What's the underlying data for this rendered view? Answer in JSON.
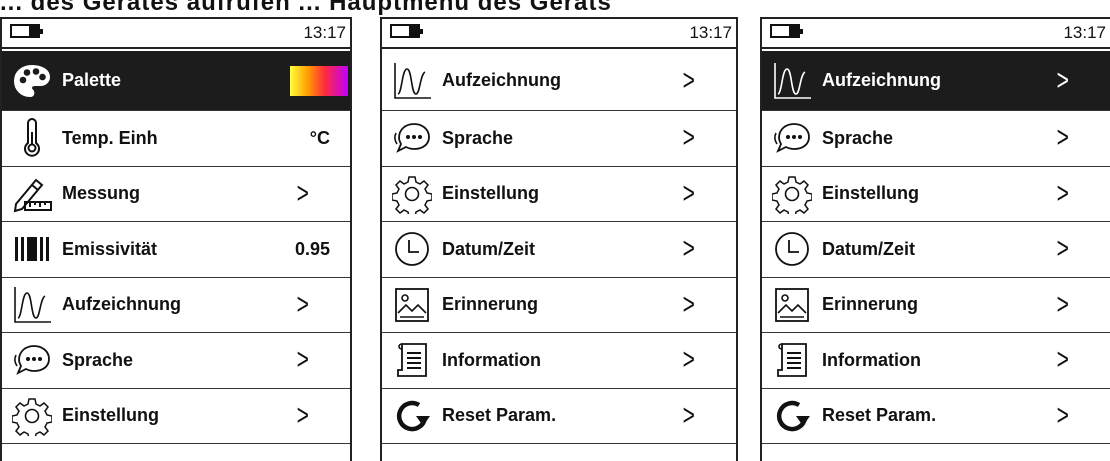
{
  "top_text": "... des Gerätes aufrufen ... Hauptmenü des Geräts",
  "screens": [
    {
      "time": "13:17",
      "items": [
        {
          "icon": "palette-icon",
          "label": "Palette",
          "value": "",
          "chevron": false,
          "selected": true,
          "gradient": true
        },
        {
          "icon": "thermometer-icon",
          "label": "Temp. Einh",
          "value": "°C",
          "chevron": false
        },
        {
          "icon": "ruler-pen-icon",
          "label": "Messung",
          "value": "",
          "chevron": true
        },
        {
          "icon": "emissivity-icon",
          "label": "Emissivität",
          "value": "0.95",
          "chevron": false
        },
        {
          "icon": "waveform-icon",
          "label": "Aufzeichnung",
          "value": "",
          "chevron": true
        },
        {
          "icon": "speech-bubble-icon",
          "label": "Sprache",
          "value": "",
          "chevron": true
        },
        {
          "icon": "gear-icon",
          "label": "Einstellung",
          "value": "",
          "chevron": true
        }
      ]
    },
    {
      "time": "13:17",
      "items": [
        {
          "icon": "waveform-icon",
          "label": "Aufzeichnung",
          "value": "",
          "chevron": true
        },
        {
          "icon": "speech-bubble-icon",
          "label": "Sprache",
          "value": "",
          "chevron": true
        },
        {
          "icon": "gear-icon",
          "label": "Einstellung",
          "value": "",
          "chevron": true
        },
        {
          "icon": "clock-icon",
          "label": "Datum/Zeit",
          "value": "",
          "chevron": true
        },
        {
          "icon": "image-icon",
          "label": "Erinnerung",
          "value": "",
          "chevron": true
        },
        {
          "icon": "document-icon",
          "label": "Information",
          "value": "",
          "chevron": true
        },
        {
          "icon": "reset-icon",
          "label": "Reset Param.",
          "value": "",
          "chevron": true
        }
      ]
    },
    {
      "time": "13:17",
      "items": [
        {
          "icon": "waveform-icon",
          "label": "Aufzeichnung",
          "value": "",
          "chevron": true,
          "selected": true
        },
        {
          "icon": "speech-bubble-icon",
          "label": "Sprache",
          "value": "",
          "chevron": true
        },
        {
          "icon": "gear-icon",
          "label": "Einstellung",
          "value": "",
          "chevron": true
        },
        {
          "icon": "clock-icon",
          "label": "Datum/Zeit",
          "value": "",
          "chevron": true
        },
        {
          "icon": "image-icon",
          "label": "Erinnerung",
          "value": "",
          "chevron": true
        },
        {
          "icon": "document-icon",
          "label": "Information",
          "value": "",
          "chevron": true
        },
        {
          "icon": "reset-icon",
          "label": "Reset Param.",
          "value": "",
          "chevron": true
        }
      ]
    }
  ],
  "chevron_glyph": ">",
  "colors": {
    "selected_bg": "#1c1c1c",
    "selected_fg": "#ffffff",
    "ink": "#111111"
  }
}
